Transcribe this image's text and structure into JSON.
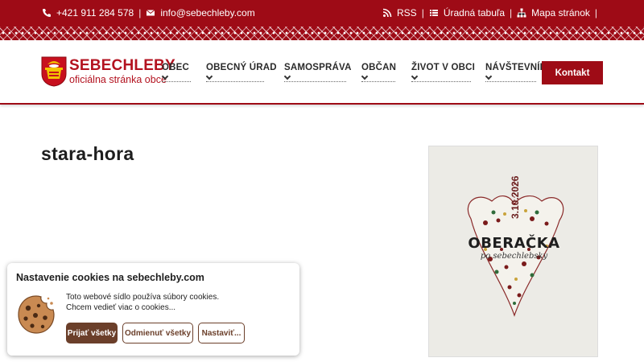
{
  "topbar": {
    "phone": "+421 911 284 578",
    "email": "info@sebechleby.com",
    "rss": "RSS",
    "board": "Úradná tabuľa",
    "sitemap": "Mapa stránok",
    "separator": "|"
  },
  "logo": {
    "name": "SEBECHLEBY",
    "subtitle": "oficiálna stránka obce"
  },
  "nav": {
    "items": [
      "OBEC",
      "OBECNÝ ÚRAD",
      "SAMOSPRÁVA",
      "OBČAN",
      "ŽIVOT V OBCI",
      "NÁVŠTEVNÍK"
    ],
    "contact": "Kontakt"
  },
  "main": {
    "title": "stara-hora"
  },
  "poster": {
    "date": "3.10.2026",
    "headline": "OBERAČKA",
    "tagline": "po sebechlebsky"
  },
  "cookie": {
    "title": "Nastavenie cookies na sebechleby.com",
    "line1": "Toto webové sídlo používa súbory cookies.",
    "line2": "Chcem vedieť viac o cookies...",
    "accept": "Prijať všetky",
    "reject": "Odmienuť všetky",
    "settings": "Nastaviť..."
  },
  "colors": {
    "brand": "#9e0b16",
    "cookie_button": "#6b3f2a"
  }
}
